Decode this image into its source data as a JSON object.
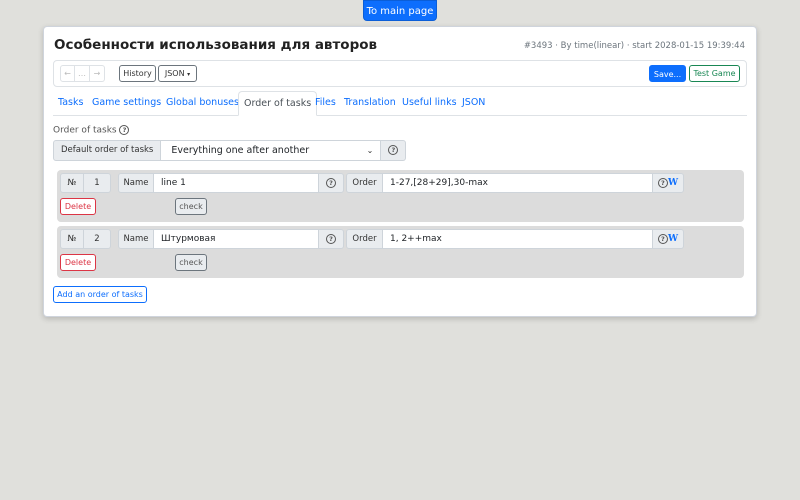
{
  "top_button": "To main page",
  "game": {
    "title": "Особенности использования для авторов",
    "meta": "#3493 · By time(linear) · start 2028-01-15 19:39:44"
  },
  "toolbar": {
    "nav_back_icon": "←",
    "nav_dots_icon": "…",
    "nav_forward_icon": "→",
    "history_label": "History",
    "json_label": "JSON",
    "json_caret": "▾",
    "save_label": "Save...",
    "test_label": "Test Game"
  },
  "tabs": [
    {
      "label": "Tasks",
      "active": false
    },
    {
      "label": "Game settings",
      "active": false
    },
    {
      "label": "Global bonuses",
      "active": false
    },
    {
      "label": "Order of tasks",
      "active": true
    },
    {
      "label": "Files",
      "active": false
    },
    {
      "label": "Translation",
      "active": false
    },
    {
      "label": "Useful links",
      "active": false
    },
    {
      "label": "JSON",
      "active": false
    }
  ],
  "section": {
    "label": "Order of tasks",
    "help_icon": "?"
  },
  "default_order": {
    "label": "Default order of tasks",
    "selected": "Everything one after another",
    "caret": "⌄",
    "help_icon": "?"
  },
  "orders": [
    {
      "num_label": "№",
      "num": "1",
      "name_label": "Name",
      "name": "line 1",
      "help_icon": "?",
      "order_label": "Order",
      "order": "1-27,[28+29],30-max",
      "help_w_q": "?",
      "help_w": "W",
      "delete_label": "Delete",
      "check_label": "check"
    },
    {
      "num_label": "№",
      "num": "2",
      "name_label": "Name",
      "name": "Штурмовая",
      "help_icon": "?",
      "order_label": "Order",
      "order": "1, 2++max",
      "help_w_q": "?",
      "help_w": "W",
      "delete_label": "Delete",
      "check_label": "check"
    }
  ],
  "add_order_label": "Add an order of tasks",
  "colors": {
    "primary": "#0d6efd",
    "success": "#198754",
    "danger": "#dc3545",
    "background": "#e0e0dc"
  }
}
